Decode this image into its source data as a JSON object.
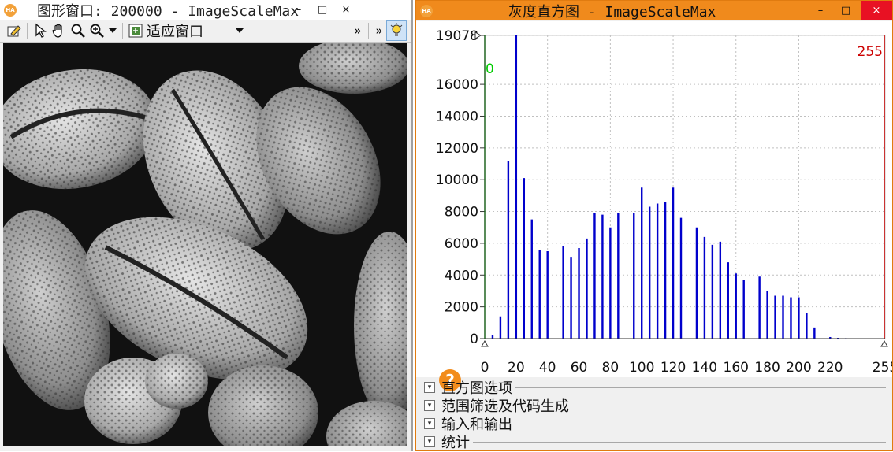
{
  "left_window": {
    "title": "图形窗口: 200000 - ImageScaleMax",
    "app_icon_text": "HA",
    "minimize": "–",
    "maximize": "□",
    "close": "×",
    "toolbar": {
      "icons": [
        "edit-icon",
        "pointer-icon",
        "hand-icon",
        "zoom-icon",
        "zoom-in-icon",
        "dropdown-arrow-icon",
        "fit-window-icon",
        "dropdown-arrow-icon",
        "more-icon",
        "more-icon",
        "bulb-icon"
      ],
      "fit_label": "适应窗口",
      "more_a": "»",
      "more_b": "»"
    }
  },
  "right_window": {
    "title": "灰度直方图 - ImageScaleMax",
    "app_icon_text": "HA",
    "minimize": "–",
    "maximize": "□",
    "close": "×",
    "lower_marker": "0",
    "upper_marker": "255",
    "help_label": "?",
    "sections": [
      "直方图选项",
      "范围筛选及代码生成",
      "输入和输出",
      "统计"
    ],
    "colors": {
      "bars": "#0000cc",
      "lower": "#00cc00",
      "upper": "#cc0000",
      "title_bar": "#f08a1c"
    }
  },
  "chart_data": {
    "type": "bar",
    "x": [
      5,
      10,
      15,
      20,
      25,
      30,
      35,
      40,
      50,
      55,
      60,
      65,
      70,
      75,
      80,
      85,
      95,
      100,
      105,
      110,
      115,
      120,
      125,
      135,
      140,
      145,
      150,
      155,
      160,
      165,
      175,
      180,
      185,
      190,
      195,
      200,
      205,
      210,
      220,
      225,
      230,
      235,
      240
    ],
    "values": [
      200,
      1400,
      11200,
      19078,
      10100,
      7500,
      5600,
      5500,
      5800,
      5100,
      5700,
      6300,
      7900,
      7800,
      7000,
      7900,
      7900,
      9500,
      8300,
      8500,
      8600,
      9500,
      7600,
      7000,
      6400,
      5900,
      6100,
      4800,
      4100,
      3700,
      3900,
      3000,
      2700,
      2700,
      2600,
      2600,
      1600,
      700,
      100,
      50,
      30,
      20,
      10
    ],
    "y_tick_labels": [
      "19078",
      "16000",
      "14000",
      "12000",
      "10000",
      "8000",
      "6000",
      "4000",
      "2000",
      "0"
    ],
    "y_ticks": [
      19078,
      16000,
      14000,
      12000,
      10000,
      8000,
      6000,
      4000,
      2000,
      0
    ],
    "x_tick_labels": [
      "0",
      "20",
      "40",
      "60",
      "80",
      "100",
      "120",
      "140",
      "160",
      "180",
      "200",
      "220",
      "255"
    ],
    "x_ticks": [
      0,
      20,
      40,
      60,
      80,
      100,
      120,
      140,
      160,
      180,
      200,
      220,
      255
    ],
    "xlim": [
      0,
      255
    ],
    "ylim": [
      0,
      19078
    ],
    "grid": true
  }
}
